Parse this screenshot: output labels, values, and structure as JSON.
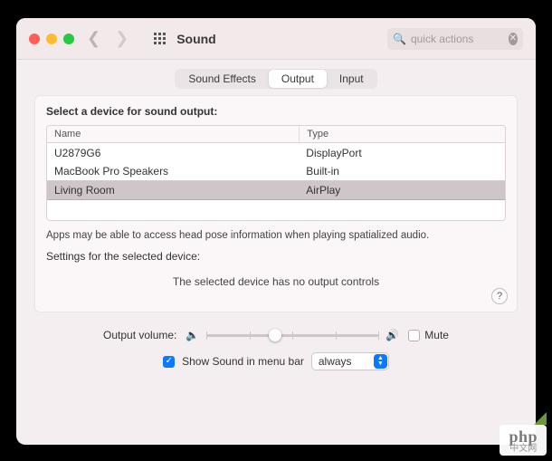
{
  "header": {
    "title": "Sound",
    "search_placeholder": "quick actions"
  },
  "tabs": [
    {
      "label": "Sound Effects"
    },
    {
      "label": "Output"
    },
    {
      "label": "Input"
    }
  ],
  "panel": {
    "heading": "Select a device for sound output:",
    "columns": {
      "name": "Name",
      "type": "Type"
    },
    "devices": [
      {
        "name": "U2879G6",
        "type": "DisplayPort",
        "selected": false
      },
      {
        "name": "MacBook Pro Speakers",
        "type": "Built-in",
        "selected": false
      },
      {
        "name": "Living Room",
        "type": "AirPlay",
        "selected": true
      }
    ],
    "hint": "Apps may be able to access head pose information when playing spatialized audio.",
    "settings_label": "Settings for the selected device:",
    "no_controls": "The selected device has no output controls",
    "help": "?"
  },
  "volume": {
    "label": "Output volume:",
    "value_percent": 40,
    "mute_label": "Mute",
    "mute_checked": false
  },
  "menubar": {
    "show_label": "Show Sound in menu bar",
    "checked": true,
    "select_value": "always"
  },
  "watermark": {
    "brand": "php",
    "sub": "中文网"
  }
}
